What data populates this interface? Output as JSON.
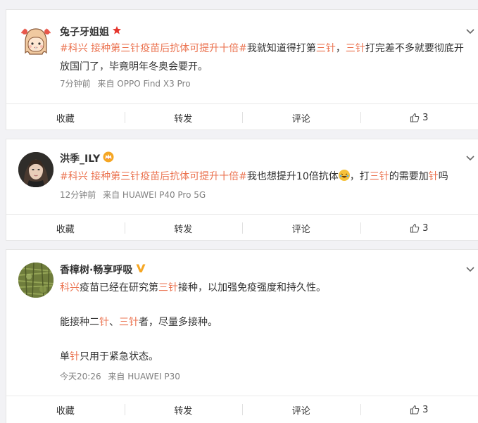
{
  "posts": [
    {
      "user": "兔子牙姐姐",
      "user_badge_icon": "red-star-icon",
      "text_parts": [
        {
          "t": "#科兴 接种第",
          "c": "tag"
        },
        {
          "t": "三针",
          "c": "hl"
        },
        {
          "t": "疫苗后抗体可提升十倍#",
          "c": "tag"
        },
        {
          "t": "我就知道得打第",
          "c": ""
        },
        {
          "t": "三针",
          "c": "hl"
        },
        {
          "t": "，",
          "c": ""
        },
        {
          "t": "三针",
          "c": "hl"
        },
        {
          "t": "打完差不多就要彻底开放国门了，毕竟明年冬奥会要开。",
          "c": ""
        }
      ],
      "time": "7分钟前",
      "source": "来自 OPPO Find X3 Pro",
      "actions": {
        "favorite": "收藏",
        "repost": "转发",
        "comment": "评论",
        "likes": "3"
      }
    },
    {
      "user": "洪季_ILY",
      "user_badge_icon": "crown-badge-icon",
      "text_parts": [
        {
          "t": "#科兴 接种第",
          "c": "tag"
        },
        {
          "t": "三针",
          "c": "hl"
        },
        {
          "t": "疫苗后抗体可提升十倍#",
          "c": "tag"
        },
        {
          "t": "我也想提升10倍抗体",
          "c": ""
        },
        {
          "t": "[emoji]",
          "c": "emoji"
        },
        {
          "t": "，打",
          "c": ""
        },
        {
          "t": "三针",
          "c": "hl"
        },
        {
          "t": "的需要加",
          "c": ""
        },
        {
          "t": "针",
          "c": "hl"
        },
        {
          "t": "吗",
          "c": ""
        }
      ],
      "time": "12分钟前",
      "source": "来自 HUAWEI P40 Pro 5G",
      "actions": {
        "favorite": "收藏",
        "repost": "转发",
        "comment": "评论",
        "likes": "3"
      }
    },
    {
      "user": "香樟树·畅享呼吸",
      "user_badge_icon": "verified-v-icon",
      "paragraphs": [
        [
          {
            "t": "科兴",
            "c": "hl"
          },
          {
            "t": "疫苗已经在研究第",
            "c": ""
          },
          {
            "t": "三针",
            "c": "hl"
          },
          {
            "t": "接种，以加强免疫强度和持久性。",
            "c": ""
          }
        ],
        [
          {
            "t": "能接种二",
            "c": ""
          },
          {
            "t": "针",
            "c": "hl"
          },
          {
            "t": "、",
            "c": ""
          },
          {
            "t": "三针",
            "c": "hl"
          },
          {
            "t": "者，尽量多接种。",
            "c": ""
          }
        ],
        [
          {
            "t": "单",
            "c": ""
          },
          {
            "t": "针",
            "c": "hl"
          },
          {
            "t": "只用于紧急状态。",
            "c": ""
          }
        ]
      ],
      "time": "今天20:26",
      "source": "来自 HUAWEI P30",
      "actions": {
        "favorite": "收藏",
        "repost": "转发",
        "comment": "评论",
        "likes": "3"
      }
    }
  ]
}
